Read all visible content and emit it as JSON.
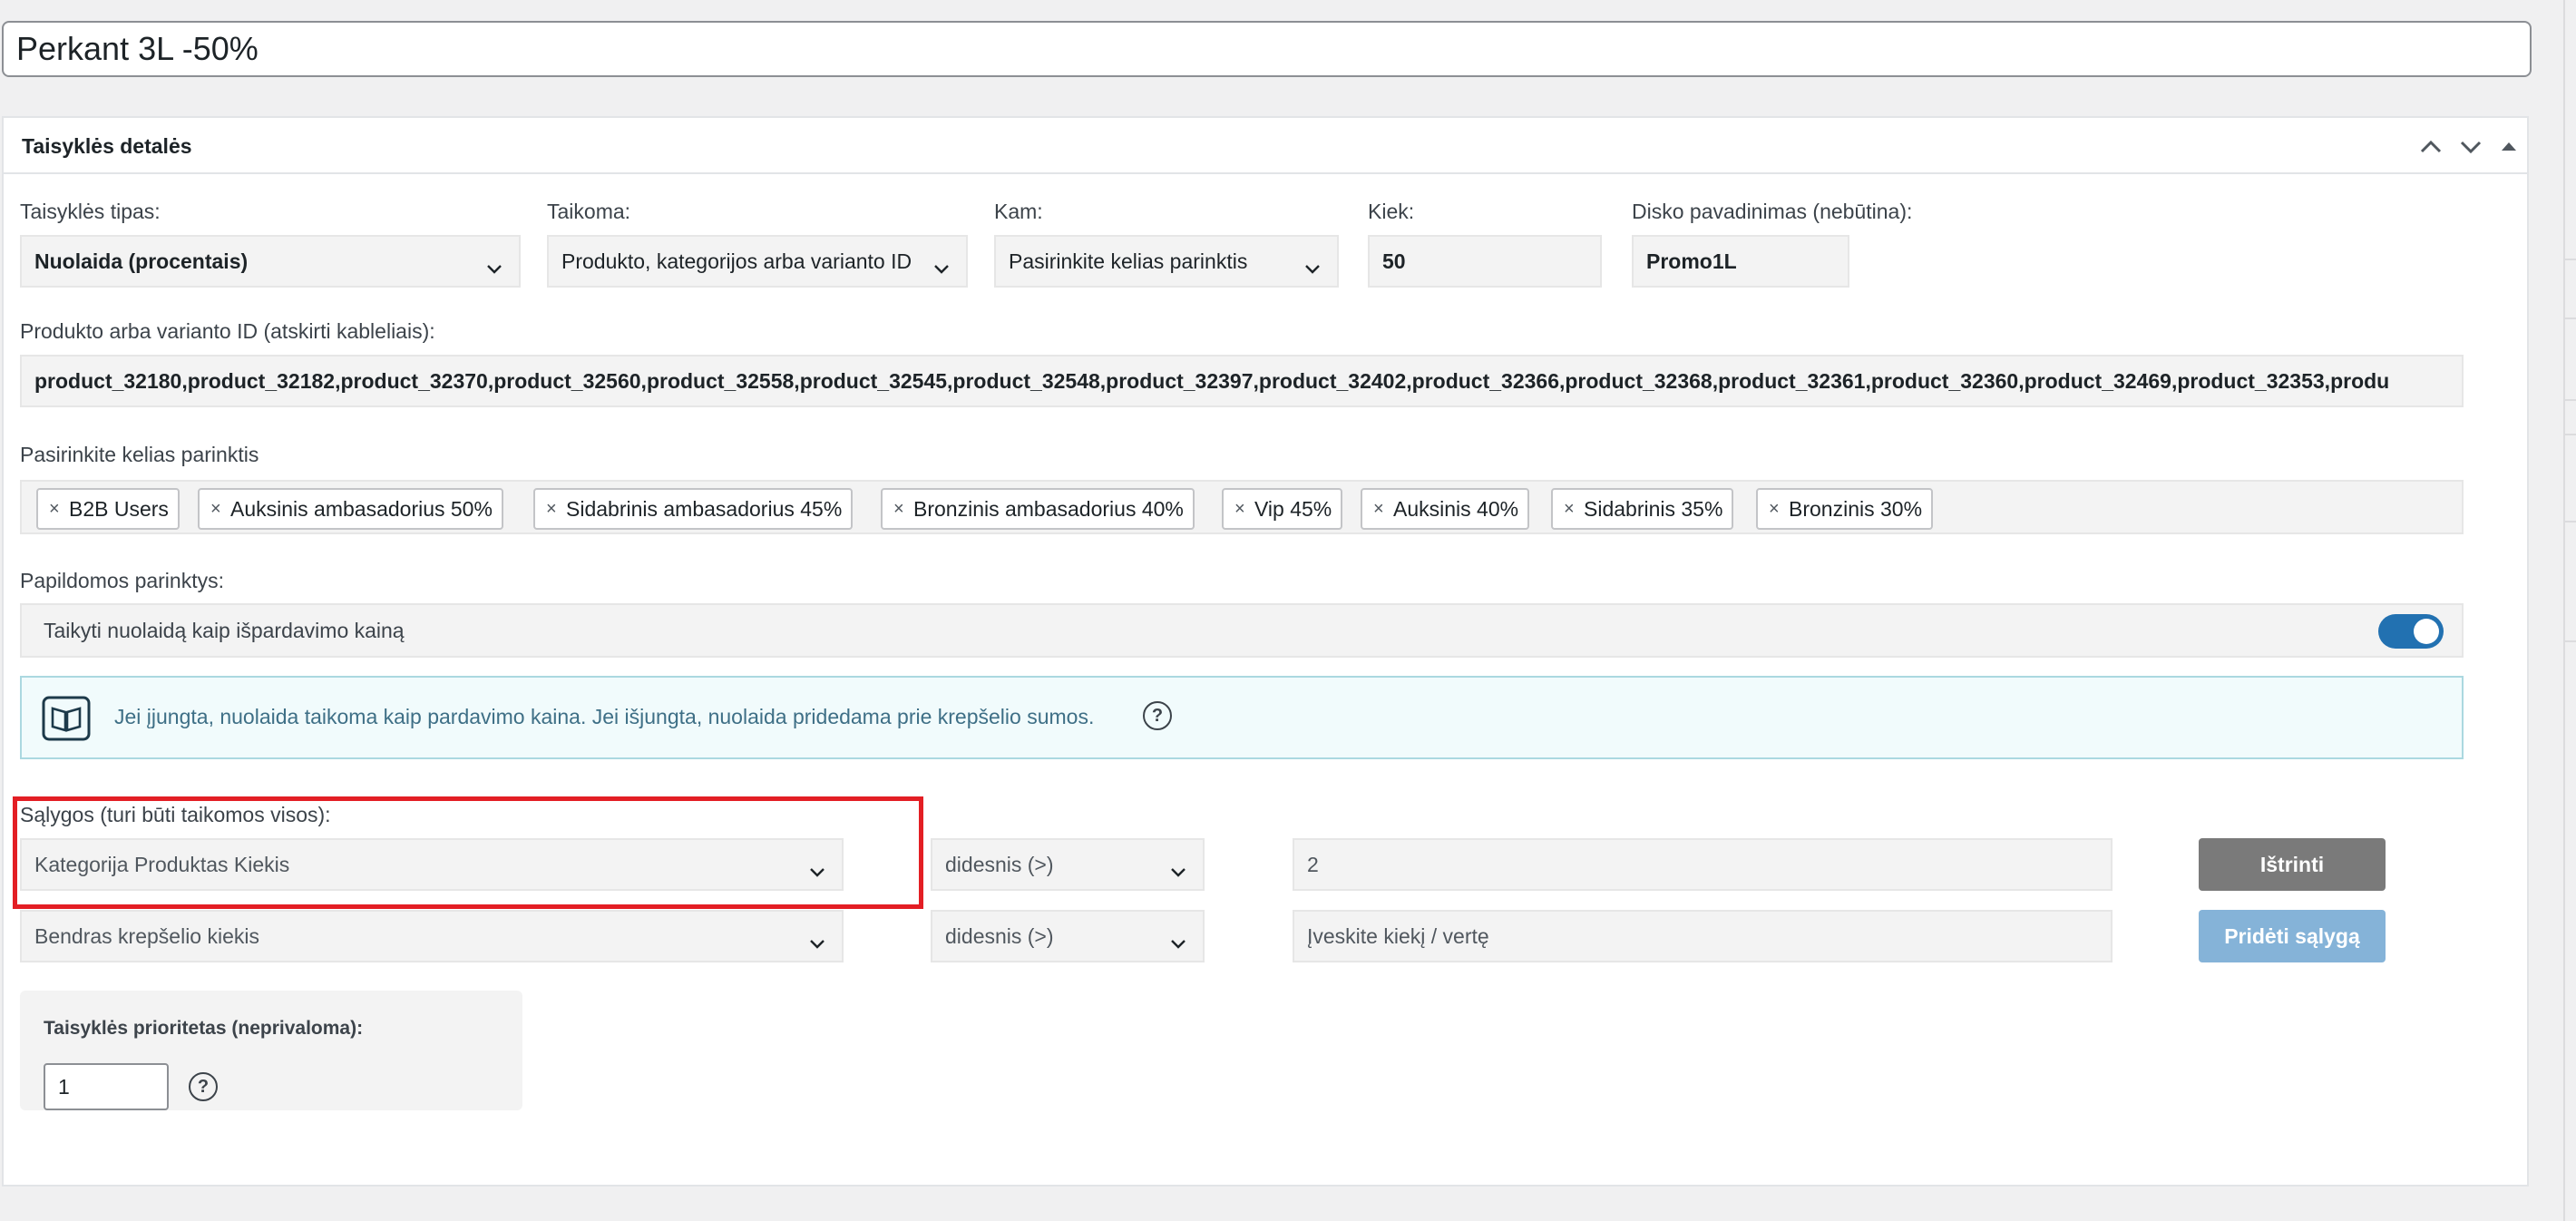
{
  "rule_title": "Perkant 3L -50%",
  "panel": {
    "title": "Taisyklės detalės"
  },
  "fields": {
    "rule_type": {
      "label": "Taisyklės tipas:",
      "value": "Nuolaida (procentais)"
    },
    "applies_to": {
      "label": "Taikoma:",
      "value": "Produkto, kategorijos arba varianto ID"
    },
    "whom": {
      "label": "Kam:",
      "value": "Pasirinkite kelias parinktis"
    },
    "amount": {
      "label": "Kiek:",
      "value": "50"
    },
    "disc_name": {
      "label": "Disko pavadinimas (nebūtina):",
      "value": "Promo1L"
    },
    "product_ids": {
      "label": "Produkto arba varianto ID (atskirti kableliais):",
      "value": "product_32180,product_32182,product_32370,product_32560,product_32558,product_32545,product_32548,product_32397,product_32402,product_32366,product_32368,product_32361,product_32360,product_32469,product_32353,produ"
    }
  },
  "multi_select": {
    "label": "Pasirinkite kelias parinktis",
    "tags": [
      "B2B Users",
      "Auksinis ambasadorius 50%",
      "Sidabrinis ambasadorius 45%",
      "Bronzinis ambasadorius 40%",
      "Vip 45%",
      "Auksinis 40%",
      "Sidabrinis 35%",
      "Bronzinis 30%"
    ]
  },
  "extra": {
    "label": "Papildomos parinktys:",
    "toggle_text": "Taikyti nuolaidą kaip išpardavimo kainą",
    "toggle_on": true
  },
  "info": {
    "text": "Jei įjungta, nuolaida taikoma kaip pardavimo kaina. Jei išjungta, nuolaida pridedama prie krepšelio sumos.",
    "help": "?"
  },
  "conditions": {
    "label": "Sąlygos (turi būti taikomos visos):",
    "rows": [
      {
        "type": "Kategorija Produktas Kiekis",
        "operator": "didesnis (>)",
        "value": "2",
        "value_placeholder": ""
      },
      {
        "type": "Bendras krepšelio kiekis",
        "operator": "didesnis (>)",
        "value": "",
        "value_placeholder": "Įveskite kiekį / vertę"
      }
    ],
    "delete_label": "Ištrinti",
    "add_label": "Pridėti sąlygą"
  },
  "priority": {
    "label": "Taisyklės prioritetas (neprivaloma):",
    "value": "1",
    "help": "?"
  },
  "colors": {
    "accent": "#2271b1",
    "highlight": "#e31e24",
    "delete_btn": "#7a7a7a",
    "add_btn": "#85b3d8"
  }
}
